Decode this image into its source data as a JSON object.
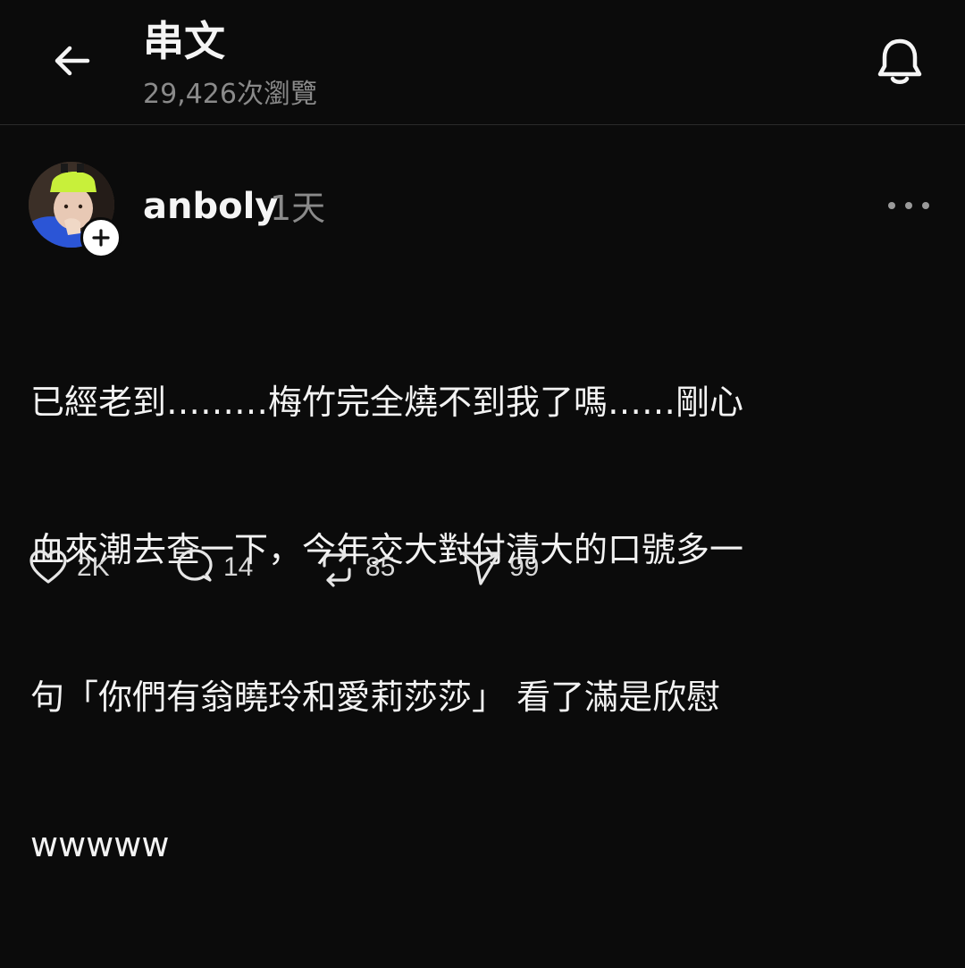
{
  "header": {
    "title": "串文",
    "views": "29,426次瀏覽"
  },
  "post": {
    "username": "anboly",
    "time": "1天",
    "content_lines": [
      "已經老到………梅竹完全燒不到我了嗎……剛心",
      "血來潮去查一下，今年交大對付清大的口號多一",
      "句「你們有翁曉玲和愛莉莎莎」 看了滿是欣慰",
      "wwwww"
    ],
    "actions": {
      "likes": "2K",
      "replies": "14",
      "reposts": "85",
      "shares": "99"
    }
  },
  "icons": {
    "back": "arrow-left-icon",
    "bell": "bell-icon",
    "follow": "plus-icon",
    "more": "more-horizontal-icon",
    "like": "heart-icon",
    "reply": "comment-icon",
    "repost": "repost-icon",
    "share": "send-icon"
  },
  "colors": {
    "background": "#0b0b0b",
    "text": "#f3f3f3",
    "muted": "#8a8a8a",
    "avatar_hat": "#c8f03a",
    "avatar_shirt": "#2b55d6"
  }
}
